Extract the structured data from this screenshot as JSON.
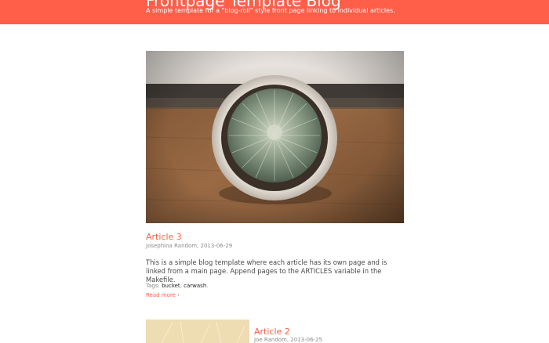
{
  "header": {
    "title": "Frontpage Template Blog",
    "subtitle": "A simple template for a \"blog-roll\" style front page linking to individual articles."
  },
  "articles": [
    {
      "title": "Article 3",
      "author": "Josephina Random",
      "date": "2013-06-29",
      "meta": "Josephina Random, 2013-06-29",
      "image": "cactus-in-pot-photo",
      "body": "This is a simple blog template where each article has its own page and is linked from a main page. Append pages to the ARTICLES variable in the Makefile.",
      "tags_label": "Tags:",
      "tags": [
        "bucket",
        "carwash"
      ],
      "read_more": "Read more ›"
    },
    {
      "title": "Article 2",
      "author": "Joe Random",
      "date": "2013-06-25",
      "meta": "Joe Random, 2013-06-25",
      "image": "cactus-close-up-photo"
    }
  ],
  "colors": {
    "accent": "#ff5e49",
    "text": "#4a4a4a",
    "muted": "#8a8a8a"
  }
}
